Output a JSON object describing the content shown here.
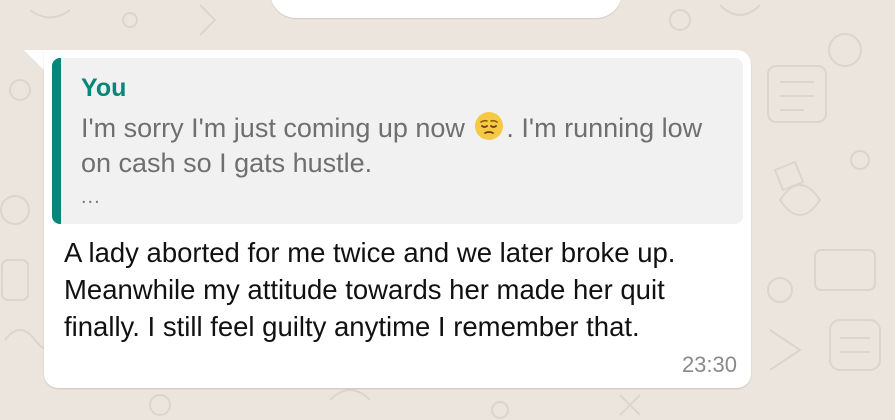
{
  "conversation": {
    "quoted_message": {
      "author": "You",
      "text_before_emoji": "I'm sorry I'm just coming up now ",
      "emoji": "pensive-face",
      "text_after_emoji": ". I'm running low on cash so I gats hustle.",
      "truncation": "..."
    },
    "message": {
      "text": "A lady aborted for me twice and we later broke up. Meanwhile my attitude towards her made her quit finally. I still feel guilty anytime I remember that.",
      "time": "23:30"
    }
  },
  "colors": {
    "wallpaper": "#ece5dd",
    "bubble": "#ffffff",
    "quote_background": "#f1f1f1",
    "quote_accent": "#06877a",
    "quote_text": "#6f6f6f",
    "message_text": "#111111",
    "timestamp": "#8a8a8a"
  }
}
